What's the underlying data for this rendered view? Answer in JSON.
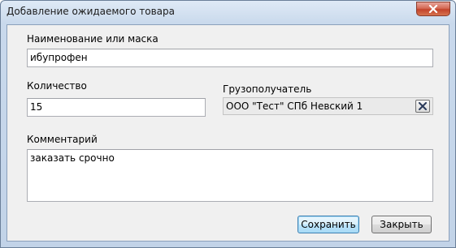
{
  "window": {
    "title": "Добавление ожидаемого товара",
    "close_icon": "close-icon"
  },
  "form": {
    "name_label": "Наименование или маска",
    "name_value": "ибупрофен",
    "qty_label": "Количество",
    "qty_value": "15",
    "consignee_label": "Грузополучатель",
    "consignee_value": "ООО \"Тест\" СПб Невский 1",
    "consignee_clear_icon": "clear-x-icon",
    "comment_label": "Комментарий",
    "comment_value": "заказать срочно"
  },
  "buttons": {
    "save_label": "Сохранить",
    "close_label": "Закрыть"
  },
  "colors": {
    "window_chrome": "#c9d9ec",
    "client_bg": "#f0f0f0",
    "close_button_red": "#c3432a",
    "default_button_border": "#3c7fb1"
  }
}
